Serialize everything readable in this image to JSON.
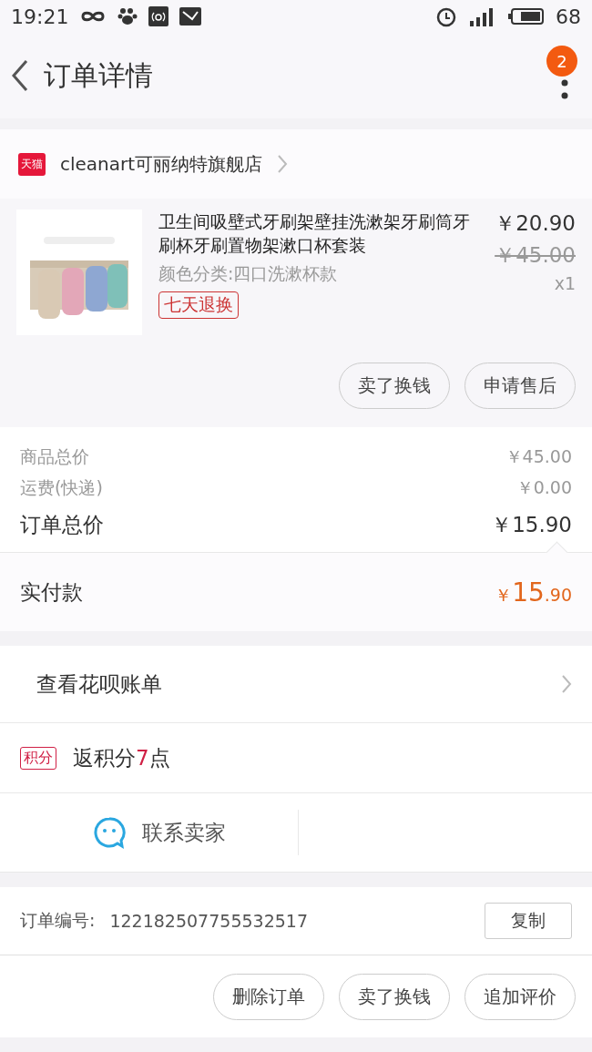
{
  "status_bar": {
    "time": "19:21",
    "battery": "68"
  },
  "header": {
    "title": "订单详情",
    "badge": "2"
  },
  "store": {
    "tag": "天猫",
    "name": "cleanart可丽纳特旗舰店"
  },
  "product": {
    "image": {
      "kind": "picture"
    },
    "title": "卫生间吸壁式牙刷架壁挂洗漱架牙刷筒牙刷杯牙刷置物架漱口杯套装",
    "variant": "颜色分类:四口洗漱杯款",
    "tag": "七天退换",
    "price": "￥20.90",
    "original_price": "￥45.00",
    "quantity": "x1",
    "actions": [
      "卖了换钱",
      "申请售后"
    ]
  },
  "summary": [
    {
      "label": "商品总价",
      "value": "￥45.00",
      "kind": "minor"
    },
    {
      "label": "运费(快递)",
      "value": "￥0.00",
      "kind": "minor"
    },
    {
      "label": "订单总价",
      "value": "￥15.90",
      "kind": "major"
    }
  ],
  "paid": {
    "label": "实付款",
    "currency": "￥",
    "integer": "15",
    "decimal": ".90"
  },
  "huabei": {
    "label": "查看花呗账单"
  },
  "points": {
    "tag": "积分",
    "prefix": "返积分",
    "value": "7",
    "suffix": "点"
  },
  "contact": {
    "label": "联系卖家"
  },
  "order": {
    "label": "订单编号:",
    "number": "122182507755532517",
    "copy": "复制"
  },
  "bottom_actions": [
    "删除订单",
    "卖了换钱",
    "追加评价"
  ]
}
